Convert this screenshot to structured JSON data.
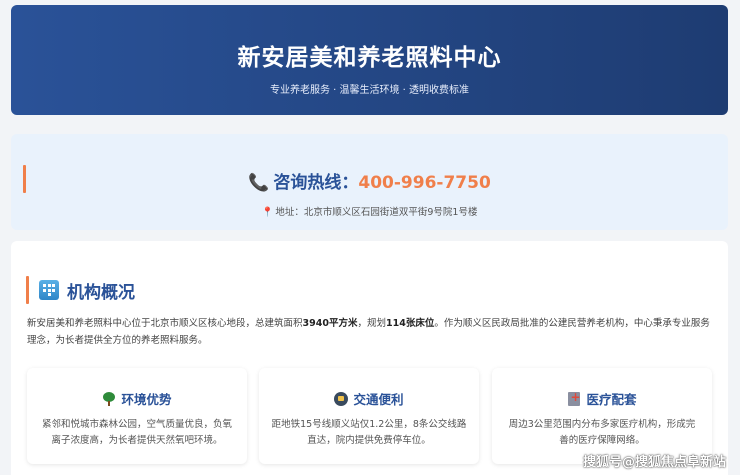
{
  "hero": {
    "title": "新安居美和养老照料中心",
    "subtitle": "专业养老服务 · 温馨生活环境 · 透明收费标准"
  },
  "contact": {
    "phone_icon": "📞",
    "hotline_label": "咨询热线：",
    "hotline_number": "400-996-7750",
    "pin_icon": "📍",
    "address": "地址：北京市顺义区石园街道双平街9号院1号楼"
  },
  "overview": {
    "title": "机构概况",
    "intro_1": "新安居美和养老照料中心位于北京市顺义区核心地段，总建筑面积",
    "area": "3940平方米",
    "intro_2": "，规划",
    "beds": "114张床位",
    "intro_3": "。作为顺义区民政局批准的公建民营养老机构，中心秉承专业服务理念，为长者提供全方位的养老照料服务。",
    "cards": [
      {
        "icon": "tree-icon",
        "title": "环境优势",
        "text": "紧邻和悦城市森林公园，空气质量优良，负氧离子浓度高，为长者提供天然氧吧环境。"
      },
      {
        "icon": "bus-icon",
        "title": "交通便利",
        "text": "距地铁15号线顺义站仅1.2公里，8条公交线路直达，院内提供免费停车位。"
      },
      {
        "icon": "hospital-icon",
        "title": "医疗配套",
        "text": "周边3公里范围内分布多家医疗机构，形成完善的医疗保障网络。"
      }
    ]
  },
  "watermark": "搜狐号@搜狐焦点阜新站",
  "colors": {
    "accent": "#2a5298",
    "highlight": "#f07f4a",
    "hero_dark": "#1e3c72"
  }
}
